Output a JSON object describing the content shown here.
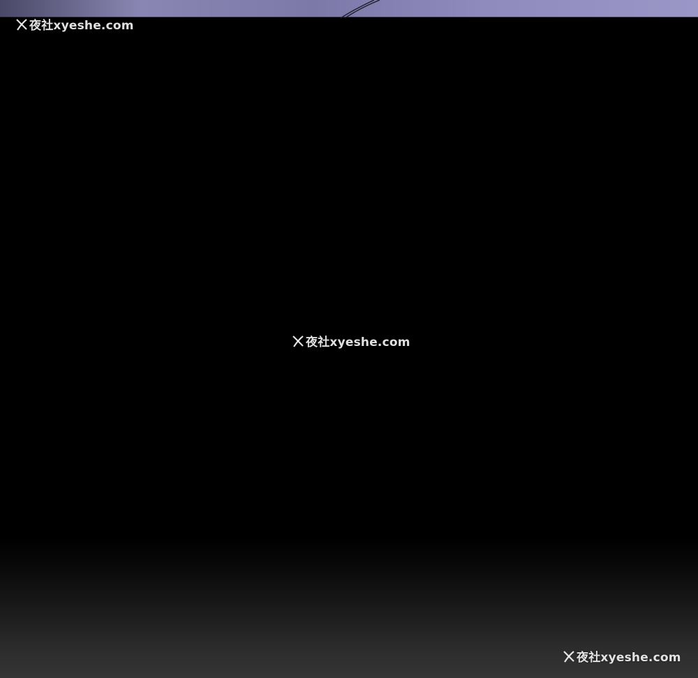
{
  "watermark": {
    "text": "夜社xyeshe.com",
    "icon": "x-logo-icon"
  },
  "colors": {
    "panel_top": "#8a86b3",
    "background": "#000000",
    "bottom_fade": "#353535"
  }
}
